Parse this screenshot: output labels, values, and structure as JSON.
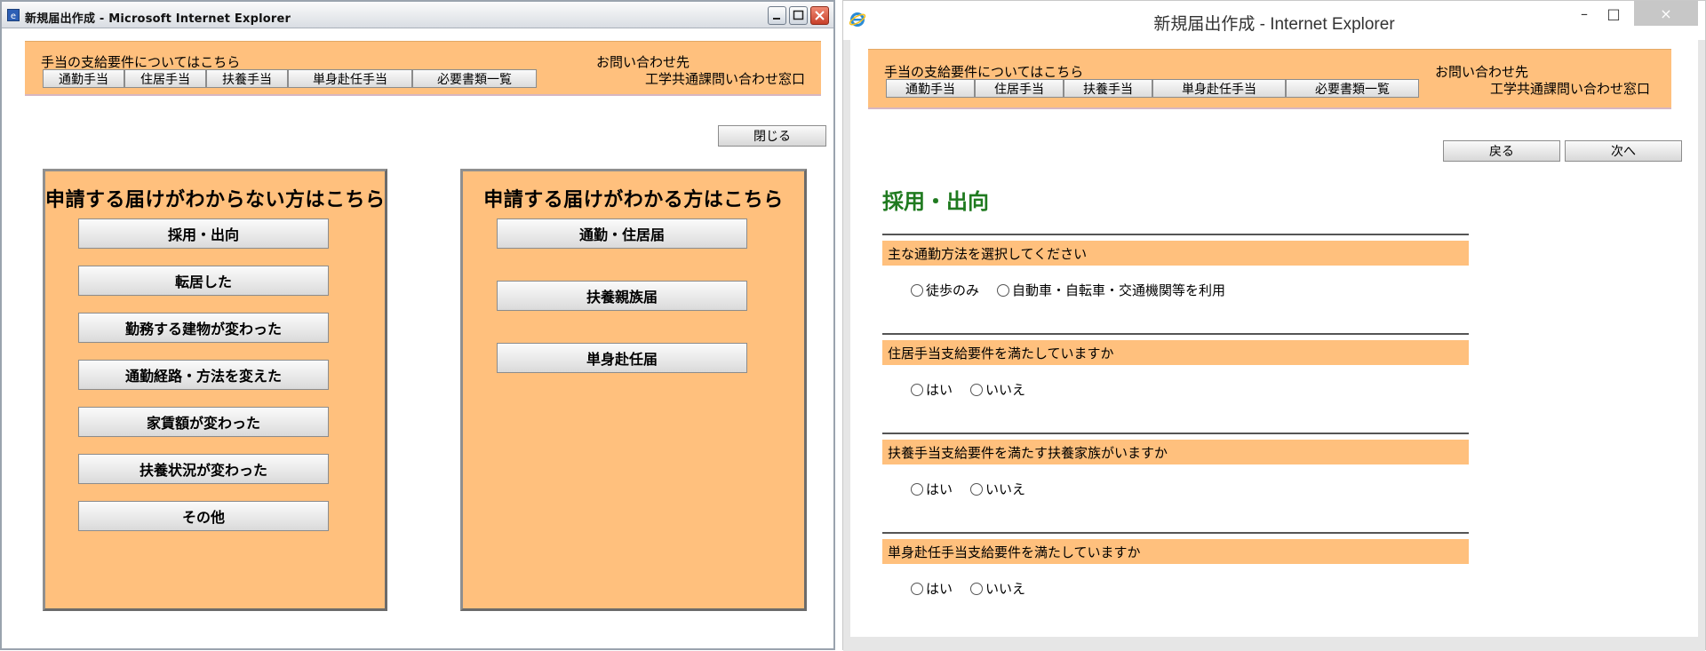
{
  "left_window": {
    "title": "新規届出作成 - Microsoft Internet Explorer",
    "header": {
      "requirements_link": "手当の支給要件についてはこちら",
      "nav": [
        "通勤手当",
        "住居手当",
        "扶養手当",
        "単身赴任手当",
        "必要書類一覧"
      ],
      "contact_heading": "お問い合わせ先",
      "contact_name": "工学共通課問い合わせ窓口"
    },
    "close_button": "閉じる",
    "panel_unknown": {
      "title": "申請する届けがわからない方はこちら",
      "buttons": [
        "採用・出向",
        "転居した",
        "勤務する建物が変わった",
        "通勤経路・方法を変えた",
        "家賃額が変わった",
        "扶養状況が変わった",
        "その他"
      ]
    },
    "panel_known": {
      "title": "申請する届けがわかる方はこちら",
      "buttons": [
        "通勤・住居届",
        "扶養親族届",
        "単身赴任届"
      ]
    }
  },
  "right_window": {
    "title": "新規届出作成 - Internet Explorer",
    "window_controls": {
      "minimize": "–",
      "maximize": "□",
      "close": "×"
    },
    "header": {
      "requirements_link": "手当の支給要件についてはこちら",
      "nav": [
        "通勤手当",
        "住居手当",
        "扶養手当",
        "単身赴任手当",
        "必要書類一覧"
      ],
      "contact_heading": "お問い合わせ先",
      "contact_name": "工学共通課問い合わせ窓口"
    },
    "back_button": "戻る",
    "next_button": "次へ",
    "section_title": "採用・出向",
    "questions": [
      {
        "text": "主な通勤方法を選択してください",
        "options": [
          "徒歩のみ",
          "自動車・自転車・交通機関等を利用"
        ]
      },
      {
        "text": "住居手当支給要件を満たしていますか",
        "options": [
          "はい",
          "いいえ"
        ]
      },
      {
        "text": "扶養手当支給要件を満たす扶養家族がいますか",
        "options": [
          "はい",
          "いいえ"
        ]
      },
      {
        "text": "単身赴任手当支給要件を満たしていますか",
        "options": [
          "はい",
          "いいえ"
        ]
      }
    ]
  },
  "colors": {
    "band": "#ffc07d",
    "section_title": "#1f7a1f"
  }
}
